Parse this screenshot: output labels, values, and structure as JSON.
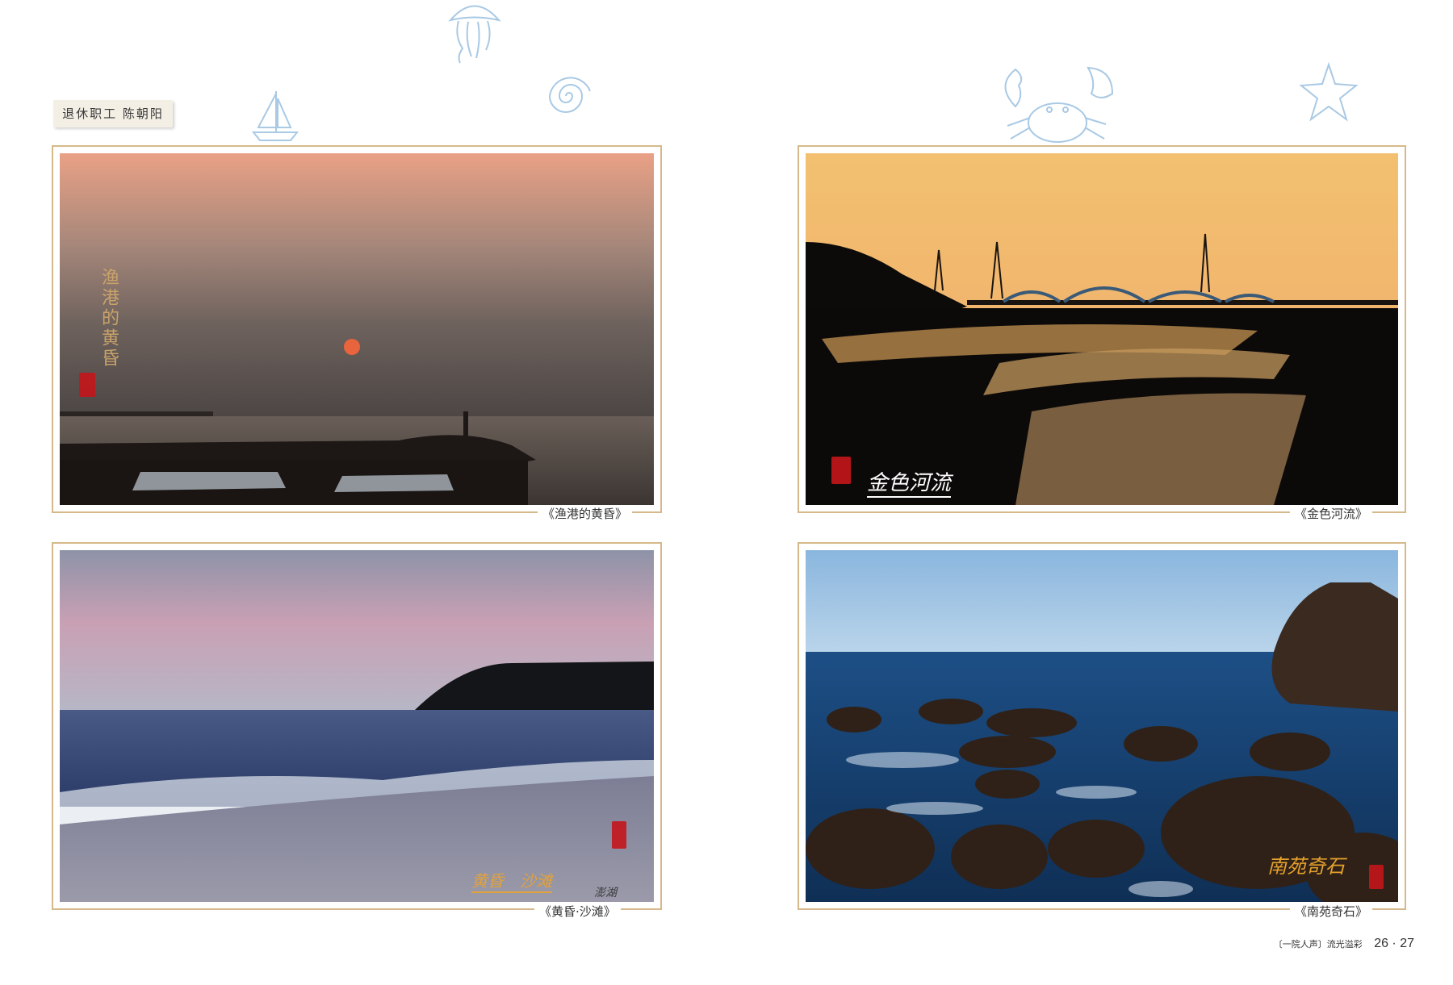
{
  "author": "退休职工 陈朝阳",
  "photos": [
    {
      "caption": "《渔港的黄昏》",
      "overlay_text": "渔港的黄昏"
    },
    {
      "caption": "《金色河流》",
      "overlay_text": "金色河流"
    },
    {
      "caption": "《黄昏·沙滩》",
      "overlay_text": "黄昏　沙滩",
      "signature": "澎湖"
    },
    {
      "caption": "《南苑奇石》",
      "overlay_text": "南苑奇石"
    }
  ],
  "footer": {
    "section": "〔一院人声〕流光溢彩",
    "page_numbers": "26 · 27"
  },
  "colors": {
    "frame": "#d6b98a",
    "doodle": "#a9c9e4",
    "seal": "#c4151b"
  },
  "icons": [
    "jellyfish-icon",
    "sailboat-icon",
    "shell-icon",
    "crab-icon",
    "starfish-icon"
  ]
}
